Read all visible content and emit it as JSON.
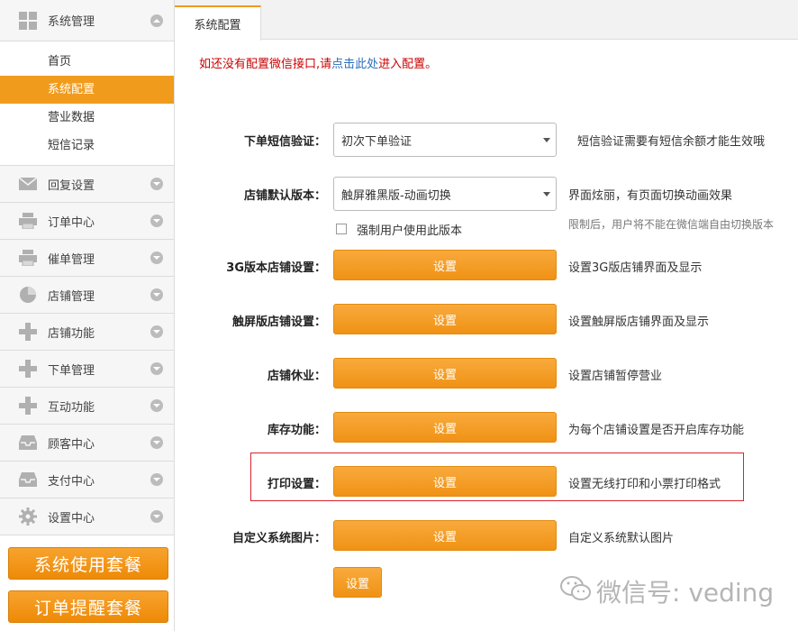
{
  "sidebar": {
    "system": {
      "label": "系统管理",
      "icon": "grid-icon"
    },
    "submenu": [
      {
        "label": "首页",
        "active": false
      },
      {
        "label": "系统配置",
        "active": true
      },
      {
        "label": "营业数据",
        "active": false
      },
      {
        "label": "短信记录",
        "active": false
      }
    ],
    "groups": [
      {
        "label": "回复设置",
        "icon": "mail-icon"
      },
      {
        "label": "订单中心",
        "icon": "printer-icon"
      },
      {
        "label": "催单管理",
        "icon": "printer-icon"
      },
      {
        "label": "店铺管理",
        "icon": "pie-chart-icon"
      },
      {
        "label": "店铺功能",
        "icon": "plus-icon"
      },
      {
        "label": "下单管理",
        "icon": "plus-icon"
      },
      {
        "label": "互动功能",
        "icon": "plus-icon"
      },
      {
        "label": "顾客中心",
        "icon": "inbox-icon"
      },
      {
        "label": "支付中心",
        "icon": "inbox-icon"
      },
      {
        "label": "设置中心",
        "icon": "gear-icon"
      }
    ],
    "packages": [
      "系统使用套餐",
      "订单提醒套餐"
    ]
  },
  "tab": {
    "label": "系统配置"
  },
  "notice": {
    "prefix": "如还没有配置微信接口,请",
    "link": "点击此处",
    "suffix": "进入配置。"
  },
  "form": {
    "sms": {
      "label": "下单短信验证：",
      "value": "初次下单验证",
      "desc": "短信验证需要有短信余额才能生效哦"
    },
    "version": {
      "label": "店铺默认版本：",
      "value": "触屏雅黑版-动画切换",
      "desc": "界面炫丽，有页面切换动画效果",
      "checkbox_label": "强制用户使用此版本",
      "desc2": "限制后，用户将不能在微信端自由切换版本"
    },
    "rows": [
      {
        "label": "3G版本店铺设置：",
        "button": "设置",
        "desc": "设置3G版店铺界面及显示"
      },
      {
        "label": "触屏版店铺设置：",
        "button": "设置",
        "desc": "设置触屏版店铺界面及显示"
      },
      {
        "label": "店铺休业：",
        "button": "设置",
        "desc": "设置店铺暂停营业"
      },
      {
        "label": "库存功能：",
        "button": "设置",
        "desc": "为每个店铺设置是否开启库存功能"
      },
      {
        "label": "打印设置：",
        "button": "设置",
        "desc": "设置无线打印和小票打印格式"
      },
      {
        "label": "自定义系统图片：",
        "button": "设置",
        "desc": "自定义系统默认图片"
      }
    ],
    "save_button": "设置"
  },
  "watermark": {
    "text": "微信号: veding"
  },
  "colors": {
    "accent": "#f19b1c",
    "highlight": "#d9232b",
    "notice": "#cc0000",
    "link": "#2a6ebd"
  }
}
